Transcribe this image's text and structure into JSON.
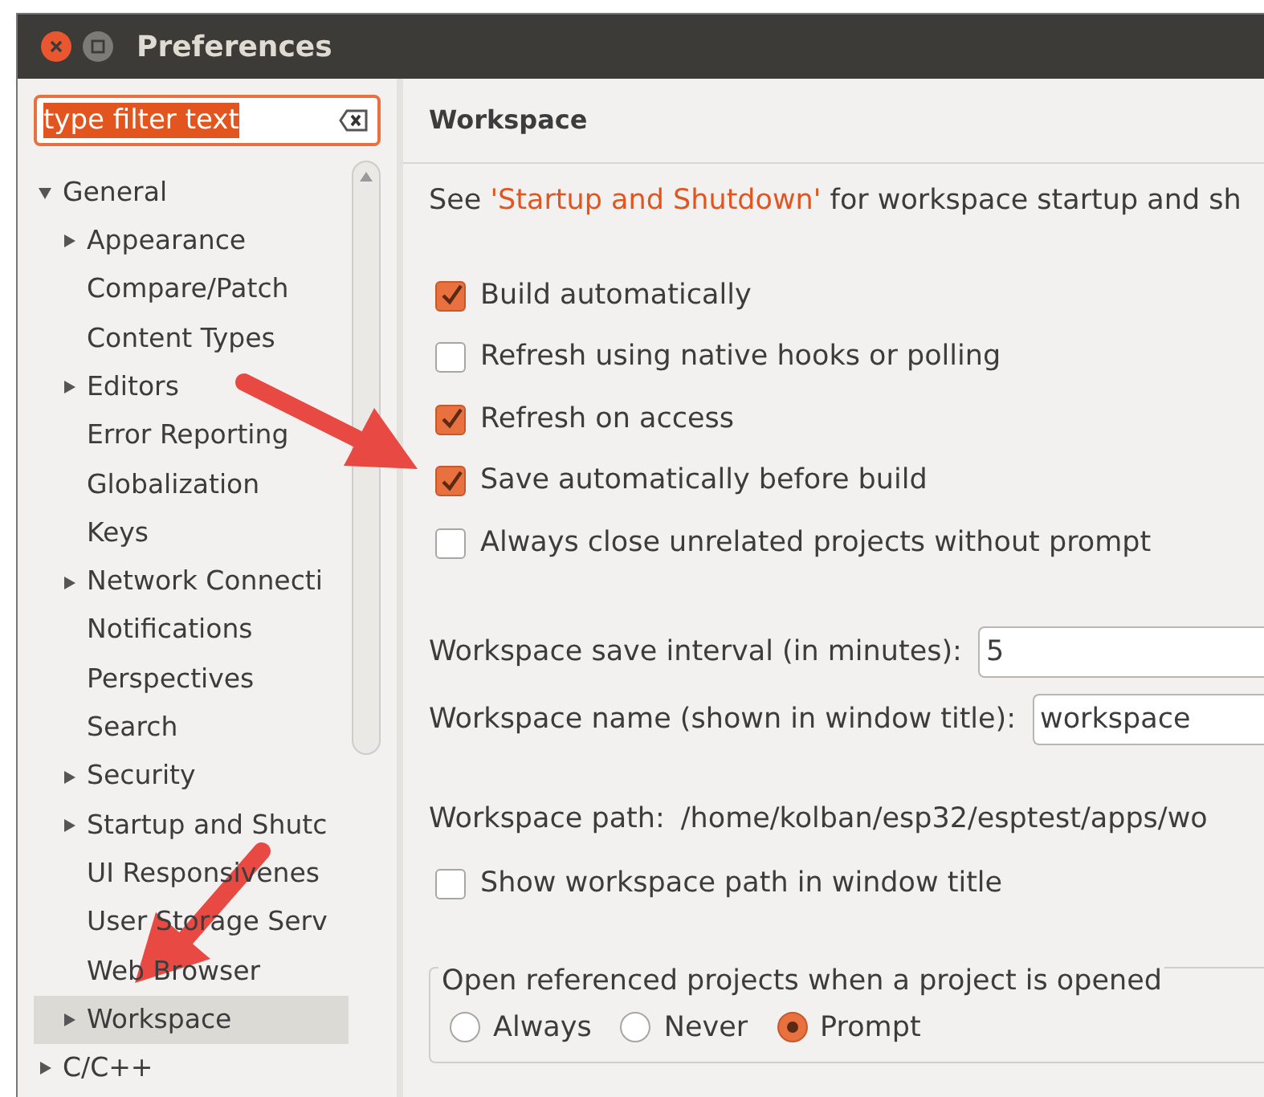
{
  "window": {
    "title": "Preferences"
  },
  "filter": {
    "value": "type filter text",
    "selected": true
  },
  "tree": [
    {
      "label": "General",
      "kind": "branch",
      "expanded": true,
      "selected": false,
      "children": [
        {
          "label": "Appearance",
          "kind": "branch",
          "expanded": false,
          "selected": false
        },
        {
          "label": "Compare/Patch",
          "kind": "leaf",
          "selected": false
        },
        {
          "label": "Content Types",
          "kind": "leaf",
          "selected": false
        },
        {
          "label": "Editors",
          "kind": "branch",
          "expanded": false,
          "selected": false
        },
        {
          "label": "Error Reporting",
          "kind": "leaf",
          "selected": false
        },
        {
          "label": "Globalization",
          "kind": "leaf",
          "selected": false
        },
        {
          "label": "Keys",
          "kind": "leaf",
          "selected": false
        },
        {
          "label": "Network Connecti",
          "kind": "branch",
          "expanded": false,
          "selected": false
        },
        {
          "label": "Notifications",
          "kind": "leaf",
          "selected": false
        },
        {
          "label": "Perspectives",
          "kind": "leaf",
          "selected": false
        },
        {
          "label": "Search",
          "kind": "leaf",
          "selected": false
        },
        {
          "label": "Security",
          "kind": "branch",
          "expanded": false,
          "selected": false
        },
        {
          "label": "Startup and Shutc",
          "kind": "branch",
          "expanded": false,
          "selected": false
        },
        {
          "label": "UI Responsivenes",
          "kind": "leaf",
          "selected": false
        },
        {
          "label": "User Storage Serv",
          "kind": "leaf",
          "selected": false
        },
        {
          "label": "Web Browser",
          "kind": "leaf",
          "selected": false
        },
        {
          "label": "Workspace",
          "kind": "branch",
          "expanded": false,
          "selected": true
        }
      ]
    },
    {
      "label": "C/C++",
      "kind": "branch",
      "expanded": false,
      "selected": false
    }
  ],
  "page": {
    "title": "Workspace",
    "intro": {
      "before": "See ",
      "link": "'Startup and Shutdown'",
      "after": " for workspace startup and sh"
    },
    "options": [
      {
        "label": "Build automatically",
        "checked": true
      },
      {
        "label": "Refresh using native hooks or polling",
        "checked": false
      },
      {
        "label": "Refresh on access",
        "checked": true
      },
      {
        "label": "Save automatically before build",
        "checked": true
      },
      {
        "label": "Always close unrelated projects without prompt",
        "checked": false
      }
    ],
    "fields": [
      {
        "label": "Workspace save interval (in minutes):",
        "value": "5"
      },
      {
        "label": "Workspace name (shown in window title):",
        "value": "workspace"
      }
    ],
    "path": {
      "label": "Workspace path:",
      "value": "/home/kolban/esp32/esptest/apps/wo"
    },
    "show_path": {
      "label": "Show workspace path in window title",
      "checked": false
    },
    "group": {
      "legend": "Open referenced projects when a project is opened",
      "choices": [
        {
          "label": "Always",
          "selected": false
        },
        {
          "label": "Never",
          "selected": false
        },
        {
          "label": "Prompt",
          "selected": true
        }
      ]
    }
  }
}
